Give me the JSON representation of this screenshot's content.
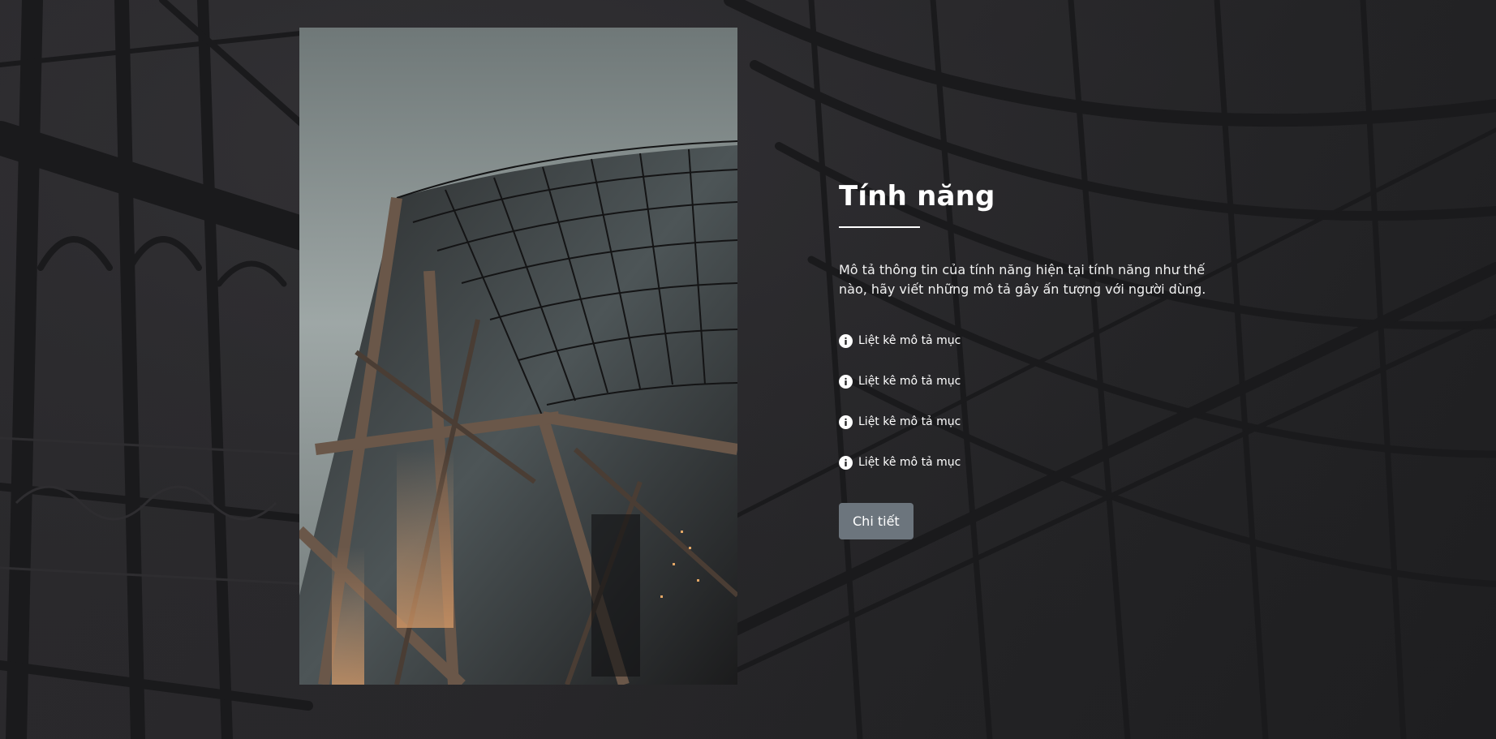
{
  "feature_section": {
    "title": "Tính năng",
    "description": "Mô tả thông tin của tính năng hiện tại tính năng như thế nào, hãy viết những mô tả gây ấn tượng với người dùng.",
    "items": [
      {
        "icon": "info-circle-icon",
        "label": "Liệt kê mô tả mục"
      },
      {
        "icon": "info-circle-icon",
        "label": "Liệt kê mô tả mục"
      },
      {
        "icon": "info-circle-icon",
        "label": "Liệt kê mô tả mục"
      },
      {
        "icon": "info-circle-icon",
        "label": "Liệt kê mô tả mục"
      }
    ],
    "button_label": "Chi tiết"
  },
  "colors": {
    "background": "#232325",
    "button": "#6c757d",
    "text": "#ffffff"
  }
}
